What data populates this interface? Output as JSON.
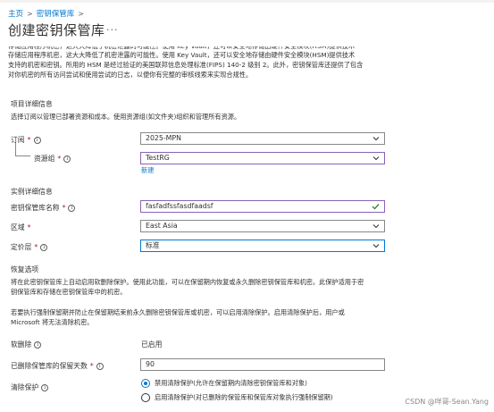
{
  "breadcrumb": {
    "home": "主页",
    "vaults": "密钥保管库"
  },
  "page_title": "创建密钥保管库",
  "more_label": "···",
  "intro": {
    "line1": "存储应用程序机密，这大大降低了机密泄露的可能性。使用 Key Vault，还可以安全地存储由硬件安全模块(HSM)提供技术",
    "line2": "支持的机密和密钥。所用的 HSM 是经过验证的美国联邦信息处理标准(FIPS) 140-2 级别 2。此外，密钥保管库还提供了包含",
    "line3": "对你机密的所有访问尝试和使用尝试的日志，以便你有完整的审核线索来实现合规性。"
  },
  "project": {
    "heading": "项目详细信息",
    "desc": "选择订阅以管理已部署资源和成本。使用资源组(如文件夹)组织和管理所有资源。",
    "subscription_label": "订阅",
    "subscription_value": "2025-MPN",
    "rg_label": "资源组",
    "rg_value": "TestRG",
    "create_new": "新建"
  },
  "instance": {
    "heading": "实例详细信息",
    "name_label": "密钥保管库名称",
    "name_value": "fasfadfssfasdfaadsf",
    "region_label": "区域",
    "region_value": "East Asia",
    "tier_label": "定价层",
    "tier_value": "标准"
  },
  "recovery": {
    "heading": "恢复选项",
    "desc1a": "将在此密钥保管库上自动启用软删除保护。使用此功能，可以在保留期内恢复或永久删除密钥保管库和机密。此保护适用于密",
    "desc1b": "钥保管库和存储在密钥保管库中的机密。",
    "desc2a": "若要执行强制保留期并防止在保留期结束前永久删除密钥保管库或机密，可以启用清除保护。启用清除保护后，用户或",
    "desc2b": "Microsoft 将无法清除机密。",
    "softdelete_label": "软删除",
    "softdelete_value": "已启用",
    "retention_label": "已删除保管库的保留天数",
    "retention_value": "90",
    "purge_label": "清除保护",
    "purge_disable": "禁用清除保护(允许在保留期内清除密钥保管库和对象)",
    "purge_enable": "启用清除保护(对已删除的保管库和保管库对象执行强制保留期)"
  },
  "watermark": "CSDN @咩哥-Sean.Yang",
  "colors": {
    "link": "#0078d4",
    "required": "#a4262c",
    "valid": "#107c10",
    "focus": "#0078d4",
    "selected_border": "#8764b8"
  }
}
